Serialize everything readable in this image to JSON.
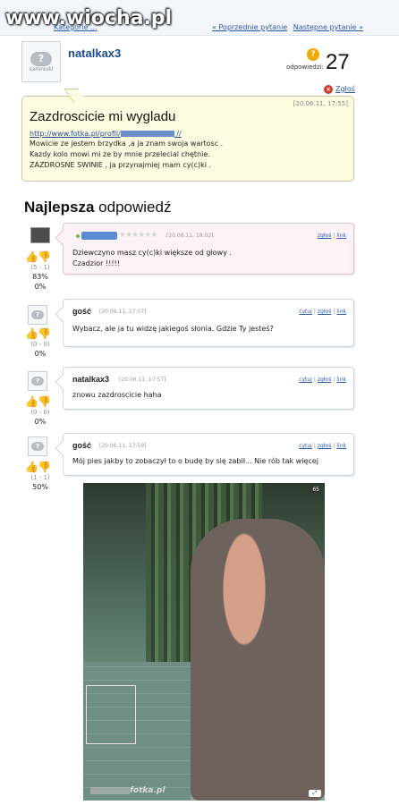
{
  "site": {
    "watermark": "www.wiocha.pl"
  },
  "nav": {
    "category": "Kategorie ...",
    "links": [
      "« Poprzednie pytanie",
      "Następne pytanie »"
    ]
  },
  "question": {
    "author": "natalkax3",
    "avatar_text": "samniuki",
    "answers_label": "odpowiedzi:",
    "answers_count": "27",
    "report_label": "Zgłoś",
    "date": "[20.06.11, 17:55]",
    "title": "Zazdroscicie mi wygladu",
    "link_prefix": "http://www.fotka.pl/profil/",
    "link_suffix": " //",
    "lines": [
      "Mowicie ze jestem brzydka ,a ja znam swoja wartosc .",
      "Kazdy kolo mowi mi ze by mnie przelecial chętnie.",
      "ZAZDROSNE SWINIE , ja przynajmiej mam cy(c)ki ."
    ]
  },
  "best_answer_heading": {
    "bold": "Najlepsza",
    "rest": " odpowiedź"
  },
  "answers": [
    {
      "best": true,
      "author": "",
      "date": "[20.06.11, 18:02]",
      "actions": [
        "zgłoś",
        "link"
      ],
      "lines": [
        "Dziewczyno masz cy(c)ki większe od głowy .",
        "Czadzior !!!!!"
      ],
      "votes": "(5 - 1)",
      "percent": "83%",
      "sub_percent": "0%"
    },
    {
      "best": false,
      "author": "gość",
      "date": "[20.06.11, 17:57]",
      "actions": [
        "cytuj",
        "zgłoś",
        "link"
      ],
      "lines": [
        "Wybacz, ale ja tu widzę jakiegoś słonia. Gdzie Ty jesteś?"
      ],
      "votes": "(0 - 0)",
      "percent": "0%"
    },
    {
      "best": false,
      "author": "natalkax3",
      "date": "[20.06.11, 17:57]",
      "actions": [
        "cytuj",
        "zgłoś",
        "link"
      ],
      "lines": [
        "znowu zazdroscicie haha"
      ],
      "votes": "(0 - 0)",
      "percent": "0%"
    },
    {
      "best": false,
      "author": "gość",
      "date": "[20.06.11, 17:59]",
      "actions": [
        "cytuj",
        "zgłoś",
        "link"
      ],
      "lines": [
        "Mój pies jakby to zobaczył to o budę by się zabił... Nie rób tak więcej"
      ],
      "votes": "(1 - 1)",
      "percent": "50%"
    }
  ],
  "photo": {
    "counter": "65",
    "watermark": "fotka.pl"
  },
  "icons": {
    "thumb_up": "thumb-up-icon",
    "thumb_down": "thumb-down-icon",
    "report": "report-icon",
    "answers": "question-icon"
  },
  "colors": {
    "link": "#2b5aa8",
    "question_bg": "#fffde1",
    "best_bg": "#fdf2f6"
  }
}
